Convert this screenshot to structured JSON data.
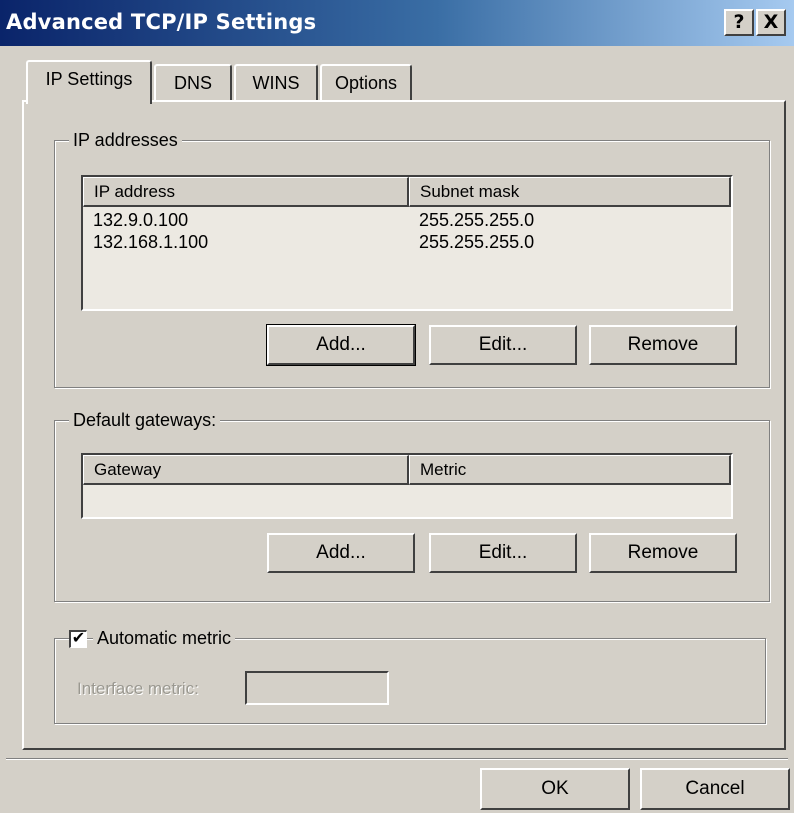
{
  "window": {
    "title": "Advanced TCP/IP Settings",
    "help_button": "?",
    "close_button": "X"
  },
  "tabs": [
    {
      "label": "IP Settings",
      "active": true
    },
    {
      "label": "DNS",
      "active": false
    },
    {
      "label": "WINS",
      "active": false
    },
    {
      "label": "Options",
      "active": false
    }
  ],
  "ip_addresses": {
    "group_label": "IP addresses",
    "columns": [
      "IP address",
      "Subnet mask"
    ],
    "rows": [
      {
        "ip": "132.9.0.100",
        "mask": "255.255.255.0"
      },
      {
        "ip": "132.168.1.100",
        "mask": "255.255.255.0"
      }
    ],
    "add_label": "Add...",
    "edit_label": "Edit...",
    "remove_label": "Remove"
  },
  "gateways": {
    "group_label": "Default gateways:",
    "columns": [
      "Gateway",
      "Metric"
    ],
    "rows": [],
    "add_label": "Add...",
    "edit_label": "Edit...",
    "remove_label": "Remove"
  },
  "metric": {
    "checkbox_label": "Automatic metric",
    "checked": true,
    "check_glyph": "✔",
    "interface_label": "Interface metric:",
    "interface_value": ""
  },
  "footer": {
    "ok_label": "OK",
    "cancel_label": "Cancel"
  }
}
